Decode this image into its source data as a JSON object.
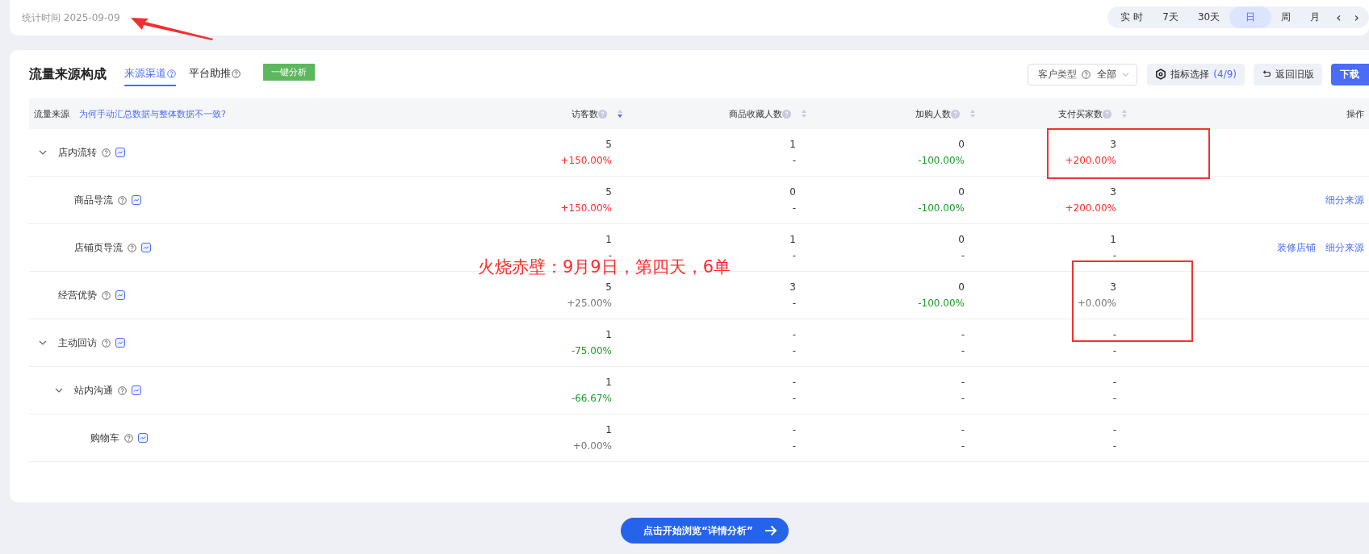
{
  "stat_bar": {
    "label": "统计时间 2025-09-09",
    "periods": [
      {
        "label": "实 时",
        "selected": false
      },
      {
        "label": "7天",
        "selected": false
      },
      {
        "label": "30天",
        "selected": false
      },
      {
        "label": "日",
        "selected": true
      },
      {
        "label": "周",
        "selected": false
      },
      {
        "label": "月",
        "selected": false
      }
    ],
    "prev": "‹",
    "next": "›"
  },
  "panel": {
    "title": "流量来源构成",
    "tabs": [
      {
        "label": "来源渠道",
        "help": true,
        "selected": true
      },
      {
        "label": "平台助推",
        "help": true,
        "selected": false
      }
    ],
    "analyze_button": "一键分析",
    "customer_type": {
      "label": "客户类型",
      "value": "全部"
    },
    "metric_button": {
      "label": "指标选择",
      "count": "(4/9)"
    },
    "old_version_button": "返回旧版",
    "download_button": "下载"
  },
  "table": {
    "name_column": {
      "label": "流量来源",
      "link": "为何手动汇总数据与整体数据不一致?"
    },
    "columns": [
      {
        "label": "访客数",
        "sorted": true
      },
      {
        "label": "商品收藏人数",
        "sorted": false
      },
      {
        "label": "加购人数",
        "sorted": false
      },
      {
        "label": "支付买家数",
        "sorted": false
      }
    ],
    "action_column": {
      "label": "操作"
    },
    "rows": [
      {
        "name": "店内流转",
        "expanded": true,
        "cells": [
          {
            "value": "5",
            "change": "+150.00%",
            "color": "#ff2a2a"
          },
          {
            "value": "1",
            "change": "-"
          },
          {
            "value": "0",
            "change": "-100.00%",
            "color": "#1a9a2a"
          },
          {
            "value": "3",
            "change": "+200.00%",
            "color": "#ff2a2a"
          }
        ],
        "children": [
          {
            "name": "商品导流",
            "cells": [
              {
                "value": "5",
                "change": "+150.00%",
                "color": "#ff2a2a"
              },
              {
                "value": "0",
                "change": "-"
              },
              {
                "value": "0",
                "change": "-100.00%",
                "color": "#1a9a2a"
              },
              {
                "value": "3",
                "change": "+200.00%",
                "color": "#ff2a2a"
              }
            ],
            "actions": [
              "细分来源"
            ]
          },
          {
            "name": "店铺页导流",
            "cells": [
              {
                "value": "1",
                "change": "-"
              },
              {
                "value": "1",
                "change": "-"
              },
              {
                "value": "0",
                "change": "-"
              },
              {
                "value": "1",
                "change": "-"
              }
            ],
            "actions": [
              "装修店铺",
              "细分来源"
            ]
          }
        ]
      },
      {
        "name": "经营优势",
        "cells": [
          {
            "value": "5",
            "change": "+25.00%",
            "color": "#777777"
          },
          {
            "value": "3",
            "change": "-"
          },
          {
            "value": "0",
            "change": "-100.00%",
            "color": "#1a9a2a"
          },
          {
            "value": "3",
            "change": "+0.00%",
            "color": "#777777"
          }
        ]
      },
      {
        "name": "主动回访",
        "expanded": true,
        "cells": [
          {
            "value": "1",
            "change": "-75.00%",
            "color": "#1a9a2a"
          },
          {
            "value": "-",
            "change": "-"
          },
          {
            "value": "-",
            "change": "-"
          },
          {
            "value": "-",
            "change": "-"
          }
        ],
        "children": [
          {
            "name": "站内沟通",
            "expanded": true,
            "cells": [
              {
                "value": "1",
                "change": "-66.67%",
                "color": "#1a9a2a"
              },
              {
                "value": "-",
                "change": "-"
              },
              {
                "value": "-",
                "change": "-"
              },
              {
                "value": "-",
                "change": "-"
              }
            ],
            "children": [
              {
                "name": "购物车",
                "cells": [
                  {
                    "value": "1",
                    "change": "+0.00%",
                    "color": "#777777"
                  },
                  {
                    "value": "-",
                    "change": "-"
                  },
                  {
                    "value": "-",
                    "change": "-"
                  },
                  {
                    "value": "-",
                    "change": "-"
                  }
                ]
              }
            ]
          }
        ]
      }
    ]
  },
  "annotation": {
    "text": "火烧赤壁：9月9日，第四天，6单"
  },
  "cta_button": "点击开始浏览“详情分析”"
}
